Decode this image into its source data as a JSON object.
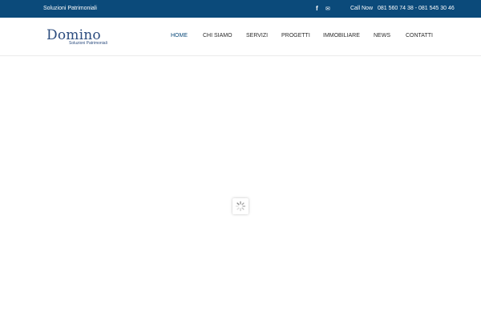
{
  "topbar": {
    "tagline": "Soluzioni Patrimoniali",
    "facebook_icon": "f",
    "mail_icon": "✉",
    "call_label": "Call Now",
    "phones": "081 560 74 38 - 081 545 30 46"
  },
  "logo": {
    "word": "Domino",
    "sub": "Soluzioni Patrimoniali"
  },
  "nav": {
    "home": "HOME",
    "chi_siamo": "CHI SIAMO",
    "servizi": "SERVIZI",
    "progetti": "PROGETTI",
    "immobiliare": "IMMOBILIARE",
    "news": "NEWS",
    "contatti": "CONTATTI",
    "active": "home"
  },
  "colors": {
    "topbar_bg": "#0b4a7a",
    "brand_blue": "#2d4d7f",
    "nav_active": "#0b4a7a",
    "nav_text": "#2b2b2b"
  },
  "icons": {
    "facebook": "facebook-icon",
    "mail": "mail-icon",
    "loader": "loading-spinner-icon"
  }
}
